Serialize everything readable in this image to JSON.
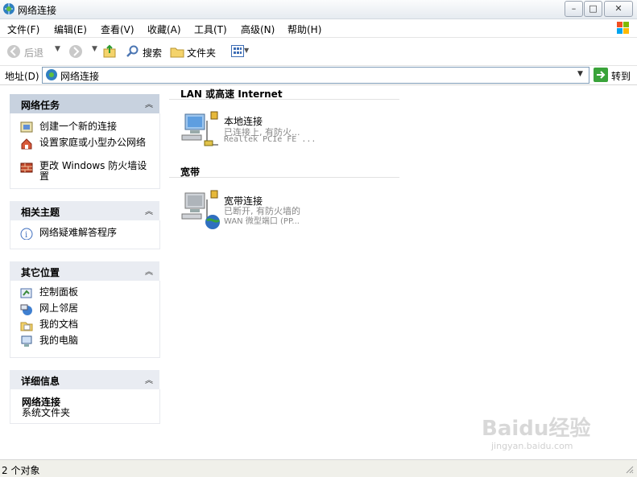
{
  "window": {
    "title": "网络连接"
  },
  "menu": [
    "文件(F)",
    "编辑(E)",
    "查看(V)",
    "收藏(A)",
    "工具(T)",
    "高级(N)",
    "帮助(H)"
  ],
  "toolbar": {
    "back": "后退",
    "search": "搜索",
    "folders": "文件夹"
  },
  "address": {
    "label": "地址(D)",
    "value": "网络连接",
    "go": "转到"
  },
  "panels": {
    "tasks": {
      "title": "网络任务",
      "items": [
        "创建一个新的连接",
        "设置家庭或小型办公网络",
        "更改 Windows 防火墙设置"
      ]
    },
    "related": {
      "title": "相关主题",
      "items": [
        "网络疑难解答程序"
      ]
    },
    "other": {
      "title": "其它位置",
      "items": [
        "控制面板",
        "网上邻居",
        "我的文档",
        "我的电脑"
      ]
    },
    "details": {
      "title": "详细信息",
      "name": "网络连接",
      "type": "系统文件夹"
    }
  },
  "groups": [
    {
      "title": "LAN 或高速 Internet",
      "connection": {
        "name": "本地连接",
        "status": "已连接上, 有防火...",
        "device": "Realtek PCIe FE ..."
      }
    },
    {
      "title": "宽带",
      "connection": {
        "name": "宽带连接",
        "status": "已断开, 有防火墙的",
        "device": "WAN 微型端口 (PP..."
      }
    }
  ],
  "status": {
    "text": "2 个对象"
  },
  "watermark": {
    "main": "Baidu经验",
    "sub": "jingyan.baidu.com"
  },
  "colors": {
    "panel_head": "#c8d2df",
    "panel_head_light": "#e9ecf2",
    "address_border": "#7f9db9",
    "status_bg": "#f0f0ea"
  }
}
